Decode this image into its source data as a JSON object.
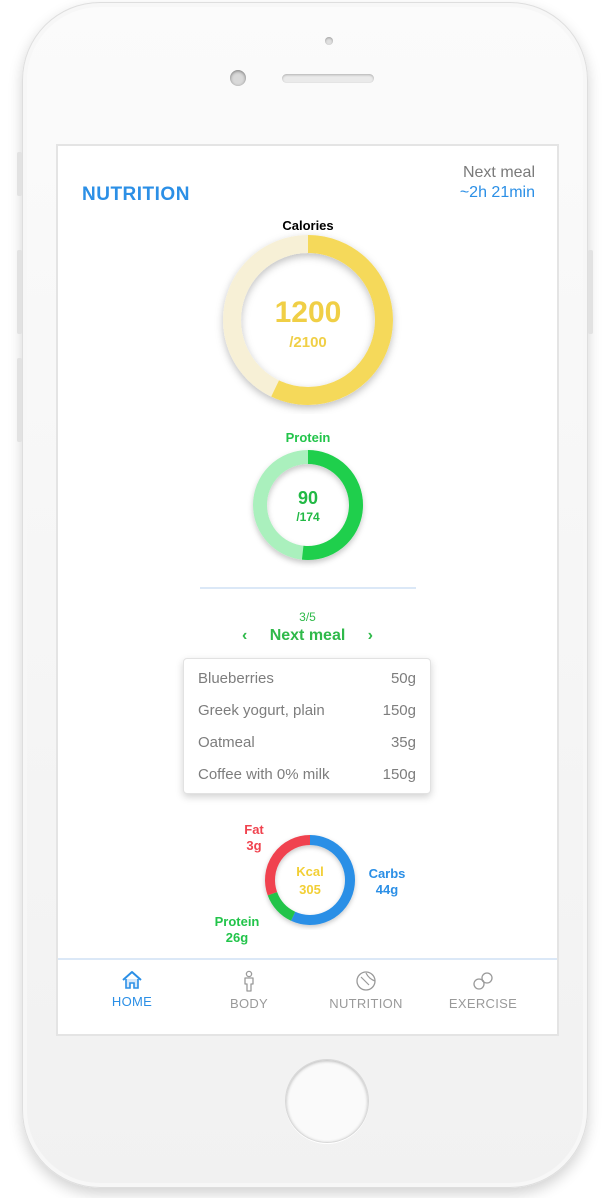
{
  "header": {
    "title": "NUTRITION",
    "next_meal_label": "Next meal",
    "next_meal_time": "~2h 21min"
  },
  "calories": {
    "label": "Calories",
    "value": "1200",
    "goal": "/2100",
    "fraction": 0.571,
    "color": "#f5d95a",
    "track": "#f7f0d6"
  },
  "protein": {
    "label": "Protein",
    "value": "90",
    "goal": "/174",
    "fraction": 0.517,
    "color": "#1fcf4c",
    "track": "#aaf0bd"
  },
  "meal": {
    "count": "3/5",
    "title": "Next meal",
    "prev_icon": "chevron-left-icon",
    "next_icon": "chevron-right-icon",
    "items": [
      {
        "name": "Blueberries",
        "amount": "50g"
      },
      {
        "name": "Greek yogurt, plain",
        "amount": "150g"
      },
      {
        "name": "Oatmeal",
        "amount": "35g"
      },
      {
        "name": "Coffee with 0% milk",
        "amount": "150g"
      }
    ]
  },
  "macros": {
    "center_label": "Kcal",
    "center_value": "305",
    "fat": {
      "label": "Fat",
      "value": "3g",
      "color": "#f0434f"
    },
    "carbs": {
      "label": "Carbs",
      "value": "44g",
      "color": "#2b8fe6"
    },
    "protein": {
      "label": "Protein",
      "value": "26g",
      "color": "#22c44a"
    },
    "center_color": "#f2cf35"
  },
  "tabs": [
    {
      "label": "HOME",
      "icon": "home-icon",
      "active": true
    },
    {
      "label": "BODY",
      "icon": "body-icon",
      "active": false
    },
    {
      "label": "NUTRITION",
      "icon": "nutrition-icon",
      "active": false
    },
    {
      "label": "EXERCISE",
      "icon": "exercise-icon",
      "active": false
    }
  ],
  "colors": {
    "accent": "#2b8fe6",
    "green": "#2fb94a",
    "inactive_tab": "#9a9a9a"
  }
}
